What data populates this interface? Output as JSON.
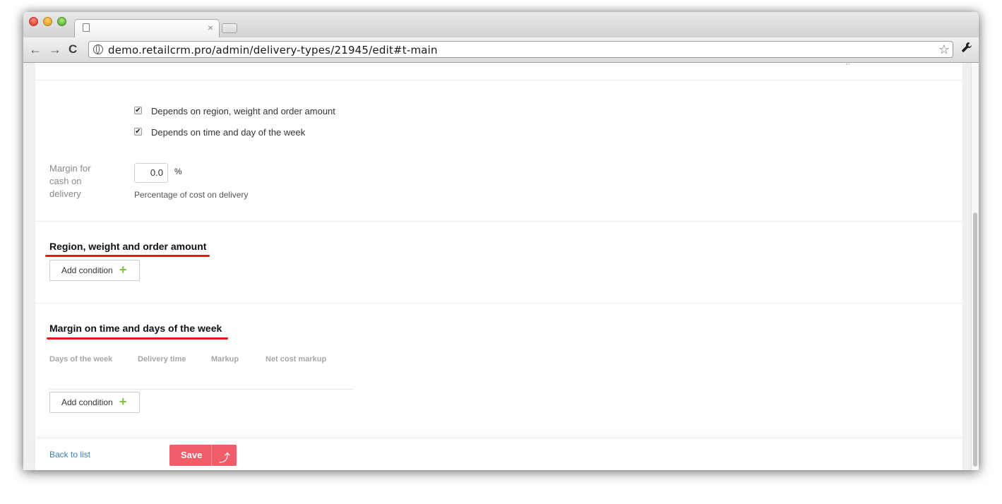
{
  "browser": {
    "tab_title": "",
    "tab_close": "×",
    "new_tab": "+",
    "url": "demo.retailcrm.pro/admin/delivery-types/21945/edit#t-main",
    "nav": {
      "back": "←",
      "forward": "→",
      "reload": "C"
    },
    "star": "☆",
    "wrench": "🔧"
  },
  "form": {
    "checkbox_region": {
      "label": "Depends on region, weight and order amount",
      "checked": true,
      "mark": "✔"
    },
    "checkbox_time": {
      "label": "Depends on time and day of the week",
      "checked": true,
      "mark": "✔"
    },
    "margin_cod": {
      "label": "Margin for cash on delivery",
      "value": "0.0",
      "unit": "%",
      "hint": "Percentage of cost on delivery"
    }
  },
  "sections": {
    "region": {
      "title": "Region, weight and order amount",
      "add_label": "Add condition",
      "add_icon": "+"
    },
    "time": {
      "title": "Margin on time and days of the week",
      "columns": [
        "Days of the week",
        "Delivery time",
        "Markup",
        "Net cost markup"
      ],
      "add_label": "Add condition",
      "add_icon": "+"
    }
  },
  "footer": {
    "back_label": "Back to list",
    "save_label": "Save",
    "save_icon": "⤴"
  },
  "colors": {
    "save": "#ef5d69",
    "underline": "#e01818",
    "plus": "#7ac143",
    "link": "#3c7fb5"
  }
}
